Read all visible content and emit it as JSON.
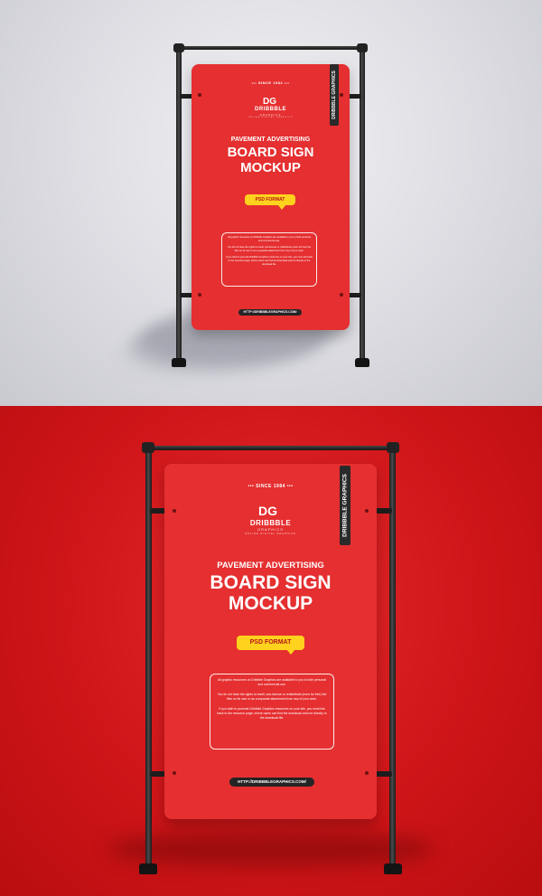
{
  "mockup": {
    "since": "••• SINCE 1984 •••",
    "brand_mark": "DG",
    "brand_name": "DRIBBBLE",
    "brand_sub": "GRAPHICS",
    "brand_tagline": "ONLINE DIGITAL GRAPHICS",
    "subheading": "PAVEMENT ADVERTISING",
    "heading_line1": "BOARD SIGN",
    "heading_line2": "MOCKUP",
    "format_label": "PSD FORMAT",
    "vertical_tag": "DRIBBBLE GRAPHICS",
    "body_p1": "All graphic resources on Dribbble Graphics are available to you to both personal and commercial use.",
    "body_p2": "You do not have the rights to resell, sub-license or redistribute (even for free) the files on its own or as a separate attachment from any of your work.",
    "body_p3": "If you wish to promote Dribbble Graphics resources on your site, you must link back to the resource page, where users can find the download and not directly to the download file.",
    "url": "HTTP://DRIBBBLEGRAPHICS.COM/"
  },
  "colors": {
    "top_background": "#dcdce2",
    "bottom_background": "#d11618",
    "sign_red": "#e52f30",
    "accent_yellow": "#ffd21e",
    "frame_black": "#1b1b1b"
  }
}
